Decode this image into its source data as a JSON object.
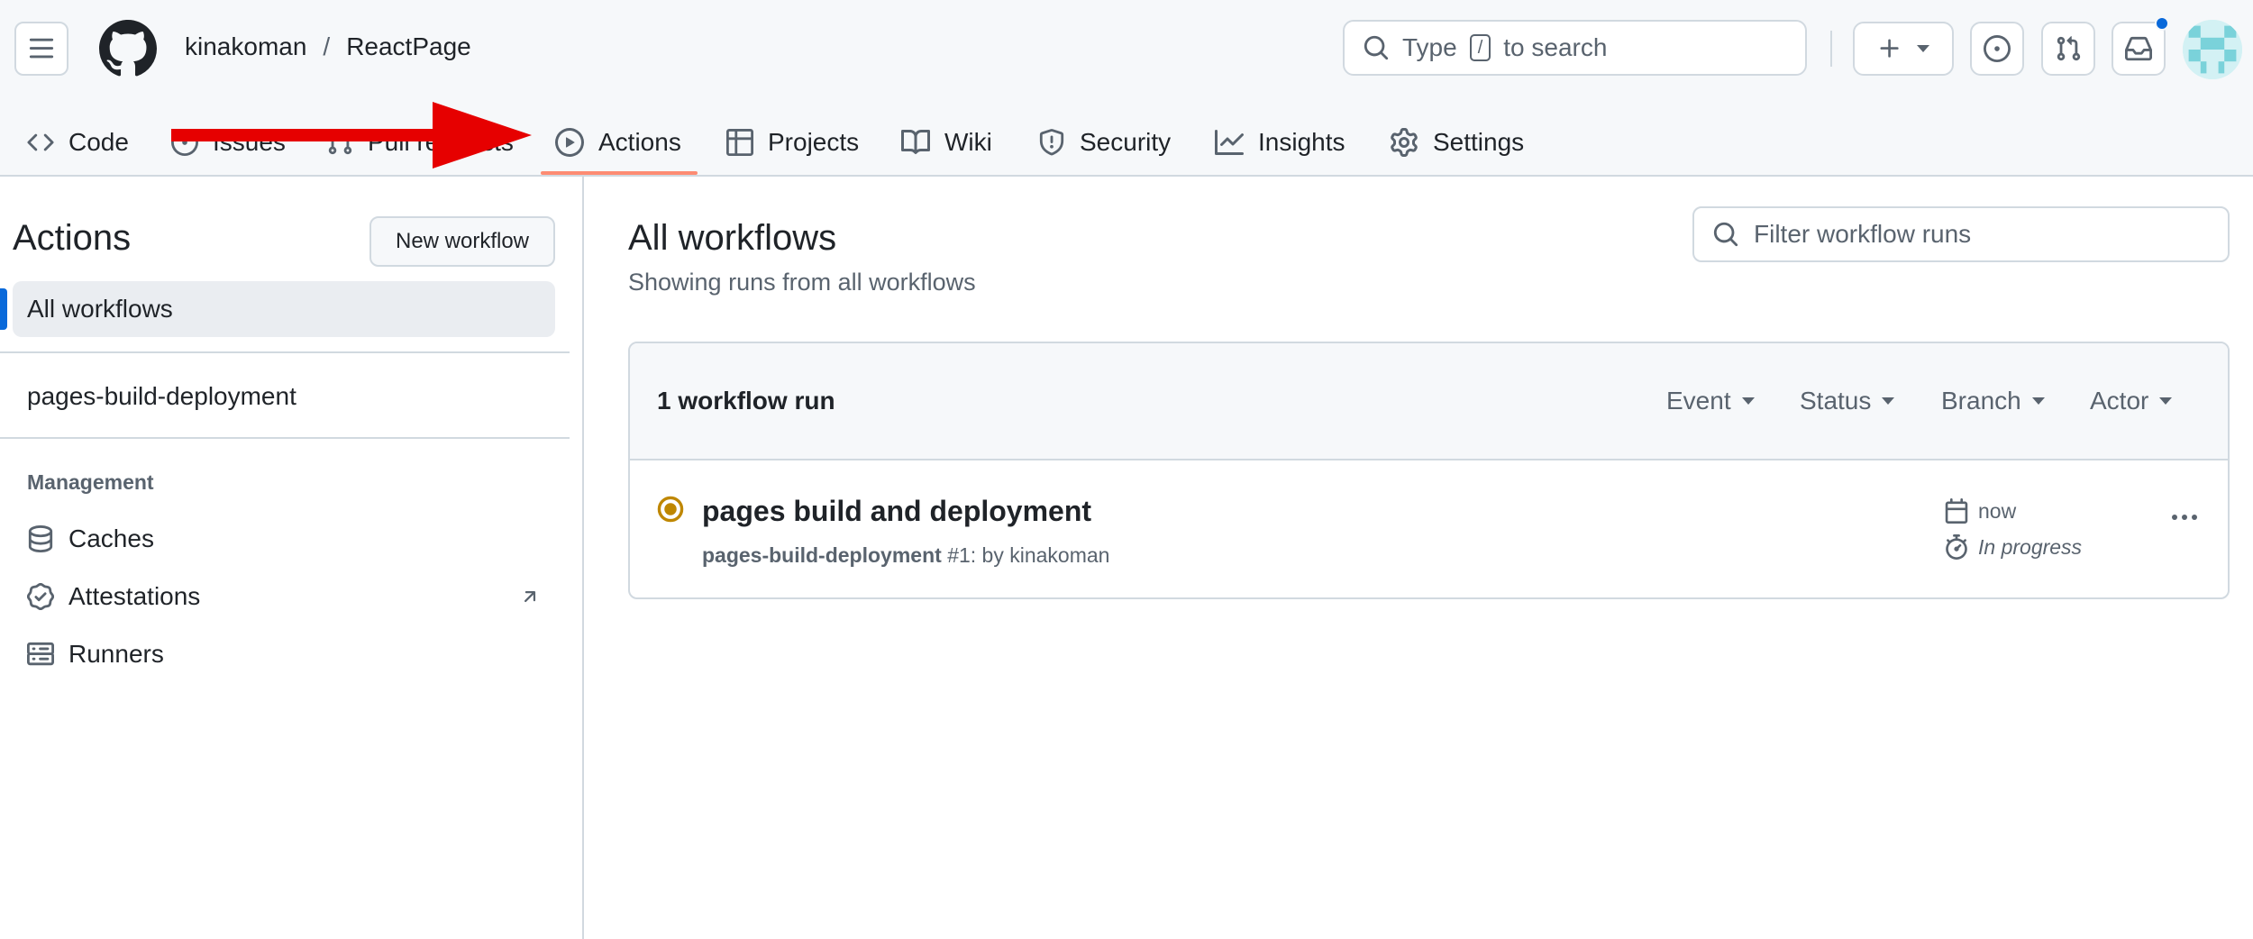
{
  "header": {
    "owner": "kinakoman",
    "separator": "/",
    "repo": "ReactPage",
    "search": {
      "prefix": "Type",
      "key": "/",
      "suffix": "to search"
    }
  },
  "tabs": [
    {
      "label": "Code",
      "icon": "code-icon"
    },
    {
      "label": "Issues",
      "icon": "issue-icon"
    },
    {
      "label": "Pull requests",
      "icon": "pull-request-icon"
    },
    {
      "label": "Actions",
      "icon": "play-icon",
      "active": true
    },
    {
      "label": "Projects",
      "icon": "table-icon"
    },
    {
      "label": "Wiki",
      "icon": "book-icon"
    },
    {
      "label": "Security",
      "icon": "shield-icon"
    },
    {
      "label": "Insights",
      "icon": "graph-icon"
    },
    {
      "label": "Settings",
      "icon": "gear-icon"
    }
  ],
  "sidebar": {
    "title": "Actions",
    "new_workflow": "New workflow",
    "active_item": "All workflows",
    "workflows": [
      "pages-build-deployment"
    ],
    "management_label": "Management",
    "management": [
      {
        "label": "Caches",
        "icon": "database-icon"
      },
      {
        "label": "Attestations",
        "icon": "verified-icon",
        "external": true
      },
      {
        "label": "Runners",
        "icon": "server-icon"
      }
    ]
  },
  "main": {
    "title": "All workflows",
    "subtitle": "Showing runs from all workflows",
    "filter_placeholder": "Filter workflow runs",
    "runs_count": "1 workflow run",
    "filters": [
      "Event",
      "Status",
      "Branch",
      "Actor"
    ],
    "run": {
      "title": "pages build and deployment",
      "workflow": "pages-build-deployment",
      "number": "#1",
      "by": ": by kinakoman",
      "time": "now",
      "duration": "In progress",
      "status_color": "#bf8700"
    }
  },
  "colors": {
    "accent": "#0969da",
    "tab_underline": "#fd8c73",
    "arrow": "#e60000"
  }
}
